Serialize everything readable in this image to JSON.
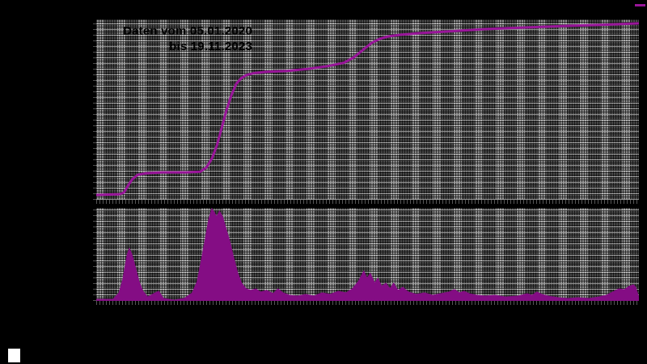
{
  "window": {
    "background_color": "#000000"
  },
  "annotation": {
    "line1": "Daten vom 05.01.2020",
    "line2": "bis 19.11.2023"
  },
  "legend": {
    "line_sample_color": "#991599"
  },
  "colors": {
    "background": "#000000",
    "cumulative_line": "#991599",
    "daily_bars": "#840d84",
    "grid_light_band": "#8f8f8f",
    "grid_dark_band": "#4c4c4c",
    "annotation_text": "#000000",
    "corner_square": "#ffffff"
  },
  "chart_data": [
    {
      "type": "line",
      "title": "Kumulative Summe (oberes Feld)",
      "xlabel": "",
      "ylabel": "",
      "x_range_dates": [
        "05.01.2020",
        "19.11.2023"
      ],
      "x_unit": "fraction_of_date_range",
      "y_unit": "percent_of_panel_height",
      "ylim": [
        0,
        100
      ],
      "grid": "on",
      "legend_position": "top-right",
      "color": "#991599",
      "stroke_width": 3,
      "points": [
        [
          0.0,
          2.7
        ],
        [
          0.043,
          3.1
        ],
        [
          0.051,
          4.0
        ],
        [
          0.058,
          7.6
        ],
        [
          0.066,
          11.2
        ],
        [
          0.076,
          13.8
        ],
        [
          0.091,
          14.7
        ],
        [
          0.121,
          15.2
        ],
        [
          0.165,
          15.2
        ],
        [
          0.192,
          15.6
        ],
        [
          0.203,
          17.9
        ],
        [
          0.213,
          22.8
        ],
        [
          0.222,
          29.9
        ],
        [
          0.231,
          39.7
        ],
        [
          0.24,
          49.6
        ],
        [
          0.249,
          58.0
        ],
        [
          0.258,
          64.3
        ],
        [
          0.267,
          67.4
        ],
        [
          0.277,
          69.2
        ],
        [
          0.292,
          70.3
        ],
        [
          0.314,
          71.0
        ],
        [
          0.352,
          71.4
        ],
        [
          0.389,
          72.5
        ],
        [
          0.426,
          74.1
        ],
        [
          0.456,
          75.9
        ],
        [
          0.475,
          79.0
        ],
        [
          0.493,
          83.5
        ],
        [
          0.508,
          87.1
        ],
        [
          0.523,
          89.3
        ],
        [
          0.538,
          90.6
        ],
        [
          0.56,
          91.5
        ],
        [
          0.598,
          92.4
        ],
        [
          0.657,
          93.5
        ],
        [
          0.717,
          94.6
        ],
        [
          0.791,
          95.5
        ],
        [
          0.866,
          96.4
        ],
        [
          0.94,
          97.1
        ],
        [
          1.0,
          97.8
        ]
      ]
    },
    {
      "type": "area",
      "title": "Tageswerte (unteres Feld)",
      "xlabel": "",
      "ylabel": "",
      "x_range_dates": [
        "05.01.2020",
        "19.11.2023"
      ],
      "x_unit": "fraction_of_date_range",
      "y_unit": "percent_of_panel_height",
      "ylim": [
        0,
        100
      ],
      "grid": "on",
      "color": "#840d84",
      "points": [
        [
          0.0,
          1.7
        ],
        [
          0.031,
          1.7
        ],
        [
          0.042,
          8.7
        ],
        [
          0.049,
          23.5
        ],
        [
          0.057,
          49.6
        ],
        [
          0.061,
          56.5
        ],
        [
          0.066,
          49.6
        ],
        [
          0.072,
          36.5
        ],
        [
          0.079,
          20.9
        ],
        [
          0.086,
          10.4
        ],
        [
          0.095,
          4.3
        ],
        [
          0.106,
          7.8
        ],
        [
          0.115,
          10.4
        ],
        [
          0.124,
          2.6
        ],
        [
          0.143,
          0.9
        ],
        [
          0.162,
          2.6
        ],
        [
          0.177,
          8.7
        ],
        [
          0.186,
          20.9
        ],
        [
          0.194,
          45.2
        ],
        [
          0.201,
          67.0
        ],
        [
          0.207,
          87.0
        ],
        [
          0.213,
          99.1
        ],
        [
          0.218,
          94.8
        ],
        [
          0.222,
          90.4
        ],
        [
          0.227,
          96.5
        ],
        [
          0.233,
          90.4
        ],
        [
          0.238,
          80.0
        ],
        [
          0.246,
          64.3
        ],
        [
          0.253,
          47.0
        ],
        [
          0.261,
          29.6
        ],
        [
          0.268,
          19.1
        ],
        [
          0.276,
          13.0
        ],
        [
          0.285,
          11.3
        ],
        [
          0.294,
          13.0
        ],
        [
          0.303,
          9.6
        ],
        [
          0.314,
          11.3
        ],
        [
          0.326,
          7.8
        ],
        [
          0.335,
          13.0
        ],
        [
          0.344,
          8.7
        ],
        [
          0.356,
          6.1
        ],
        [
          0.371,
          5.2
        ],
        [
          0.386,
          7.0
        ],
        [
          0.401,
          5.2
        ],
        [
          0.416,
          8.7
        ],
        [
          0.431,
          7.0
        ],
        [
          0.446,
          10.4
        ],
        [
          0.46,
          8.7
        ],
        [
          0.472,
          13.0
        ],
        [
          0.483,
          20.9
        ],
        [
          0.493,
          32.2
        ],
        [
          0.499,
          24.3
        ],
        [
          0.505,
          29.6
        ],
        [
          0.513,
          19.1
        ],
        [
          0.519,
          24.3
        ],
        [
          0.526,
          15.7
        ],
        [
          0.534,
          19.1
        ],
        [
          0.541,
          13.0
        ],
        [
          0.548,
          19.1
        ],
        [
          0.556,
          11.3
        ],
        [
          0.565,
          14.8
        ],
        [
          0.575,
          9.6
        ],
        [
          0.59,
          7.0
        ],
        [
          0.605,
          8.7
        ],
        [
          0.62,
          6.1
        ],
        [
          0.635,
          7.8
        ],
        [
          0.65,
          9.6
        ],
        [
          0.66,
          12.2
        ],
        [
          0.669,
          8.7
        ],
        [
          0.678,
          10.4
        ],
        [
          0.687,
          7.8
        ],
        [
          0.702,
          6.1
        ],
        [
          0.717,
          5.2
        ],
        [
          0.735,
          6.1
        ],
        [
          0.754,
          4.3
        ],
        [
          0.777,
          5.2
        ],
        [
          0.794,
          7.8
        ],
        [
          0.803,
          6.1
        ],
        [
          0.812,
          9.6
        ],
        [
          0.821,
          7.0
        ],
        [
          0.833,
          5.2
        ],
        [
          0.851,
          3.5
        ],
        [
          0.869,
          2.6
        ],
        [
          0.888,
          3.5
        ],
        [
          0.908,
          2.6
        ],
        [
          0.926,
          4.3
        ],
        [
          0.94,
          6.1
        ],
        [
          0.952,
          9.6
        ],
        [
          0.963,
          13.0
        ],
        [
          0.973,
          12.2
        ],
        [
          0.982,
          15.7
        ],
        [
          0.99,
          17.4
        ],
        [
          0.994,
          14.8
        ],
        [
          1.0,
          3.5
        ]
      ]
    }
  ]
}
